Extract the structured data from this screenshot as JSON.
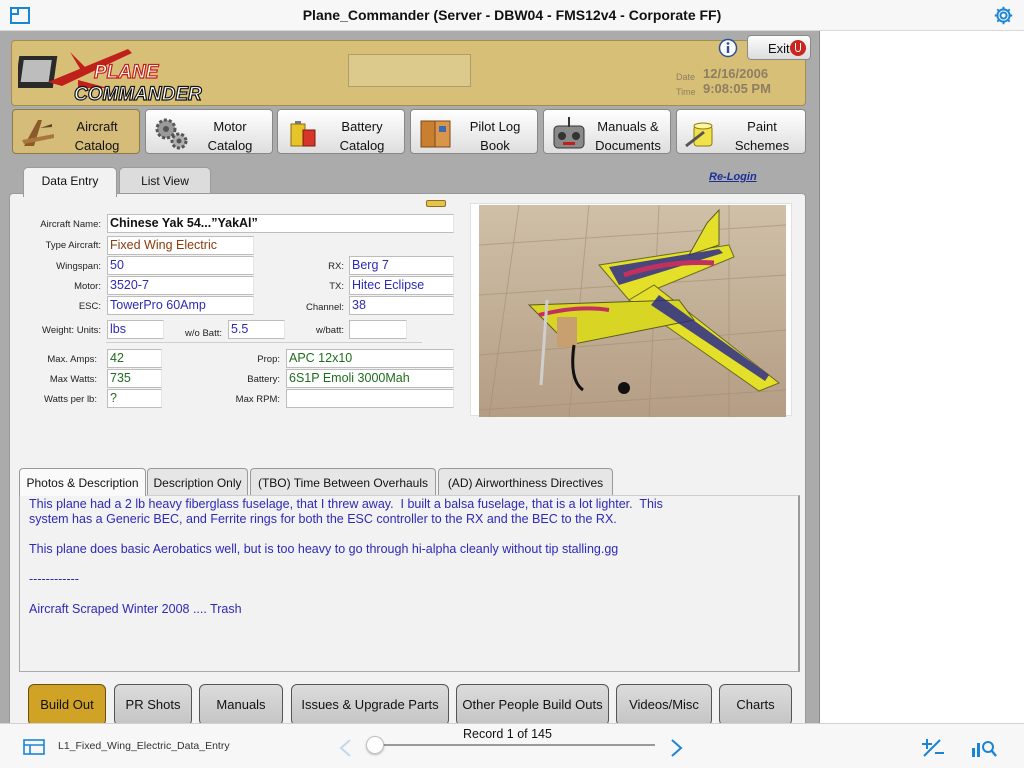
{
  "window": {
    "title": "Plane_Commander (Server - DBW04 - FMS12v4 - Corporate FF)"
  },
  "header": {
    "exit_label": "Exit",
    "date_label": "Date",
    "date_value": "12/16/2006",
    "time_label": "Time",
    "time_value": "9:08:05 PM",
    "logo_line1": "PLANE",
    "logo_line2": "COMMANDER"
  },
  "nav": [
    {
      "line1": "Aircraft",
      "line2": "Catalog",
      "icon": "aircraft-icon"
    },
    {
      "line1": "Motor",
      "line2": "Catalog",
      "icon": "gears-icon"
    },
    {
      "line1": "Battery",
      "line2": "Catalog",
      "icon": "battery-icon"
    },
    {
      "line1": "Pilot Log",
      "line2": "Book",
      "icon": "logbook-icon"
    },
    {
      "line1": "Manuals &",
      "line2": "Documents",
      "icon": "transmitter-icon"
    },
    {
      "line1": "Paint",
      "line2": "Schemes",
      "icon": "paint-icon"
    }
  ],
  "tabs": [
    "Data Entry",
    "List View"
  ],
  "relogin": "Re-Login",
  "form": {
    "aircraft_name": {
      "label": "Aircraft Name:",
      "value": "Chinese Yak 54...”YakAl”"
    },
    "type_aircraft": {
      "label": "Type Aircraft:",
      "value": "Fixed Wing Electric"
    },
    "wingspan": {
      "label": "Wingspan:",
      "value": "50"
    },
    "motor": {
      "label": "Motor:",
      "value": "3520-7"
    },
    "esc": {
      "label": "ESC:",
      "value": "TowerPro 60Amp"
    },
    "rx": {
      "label": "RX:",
      "value": "Berg 7"
    },
    "tx": {
      "label": "TX:",
      "value": "Hitec Eclipse"
    },
    "channel": {
      "label": "Channel:",
      "value": "38"
    },
    "weight_units": {
      "label": "Weight:  Units:",
      "value": "lbs"
    },
    "wo_batt": {
      "label": "w/o Batt:",
      "value": "5.5"
    },
    "w_batt": {
      "label": "w/batt:",
      "value": ""
    },
    "max_amps": {
      "label": "Max. Amps:",
      "value": "42"
    },
    "max_watts": {
      "label": "Max Watts:",
      "value": "735"
    },
    "watts_per_lb": {
      "label": "Watts per lb:",
      "value": "?"
    },
    "prop": {
      "label": "Prop:",
      "value": "APC 12x10"
    },
    "battery": {
      "label": "Battery:",
      "value": "6S1P Emoli 3000Mah"
    },
    "max_rpm": {
      "label": "Max RPM:",
      "value": ""
    }
  },
  "lower_tabs": [
    "Photos & Description",
    "Description Only",
    "(TBO) Time Between Overhauls",
    "(AD) Airworthiness Directives"
  ],
  "description": "This plane had a 2 lb heavy fiberglass fuselage, that I threw away.  I built a balsa fuselage, that is a lot lighter.  This\nsystem has a Generic BEC, and Ferrite rings for both the ESC controller to the RX and the BEC to the RX.\n\nThis plane does basic Aerobatics well, but is too heavy to go through hi-alpha cleanly without tip stalling.gg\n\n------------\n\nAircraft Scraped Winter 2008 .... Trash",
  "section_buttons": [
    "Build Out",
    "PR Shots",
    "Manuals",
    "Issues & Upgrade Parts",
    "Other People Build Outs",
    "Videos/Misc",
    "Charts"
  ],
  "footer": {
    "layout_name": "L1_Fixed_Wing_Electric_Data_Entry",
    "record_text": "Record 1 of 145",
    "record_position_fraction": 0.0
  },
  "colors": {
    "accent": "#1a85d6",
    "header_gold": "#d8bf77",
    "active_gold": "#d0a226",
    "value_blue": "#2d2ab8",
    "value_green": "#1c6e1c",
    "value_brown": "#8a3c0c"
  }
}
